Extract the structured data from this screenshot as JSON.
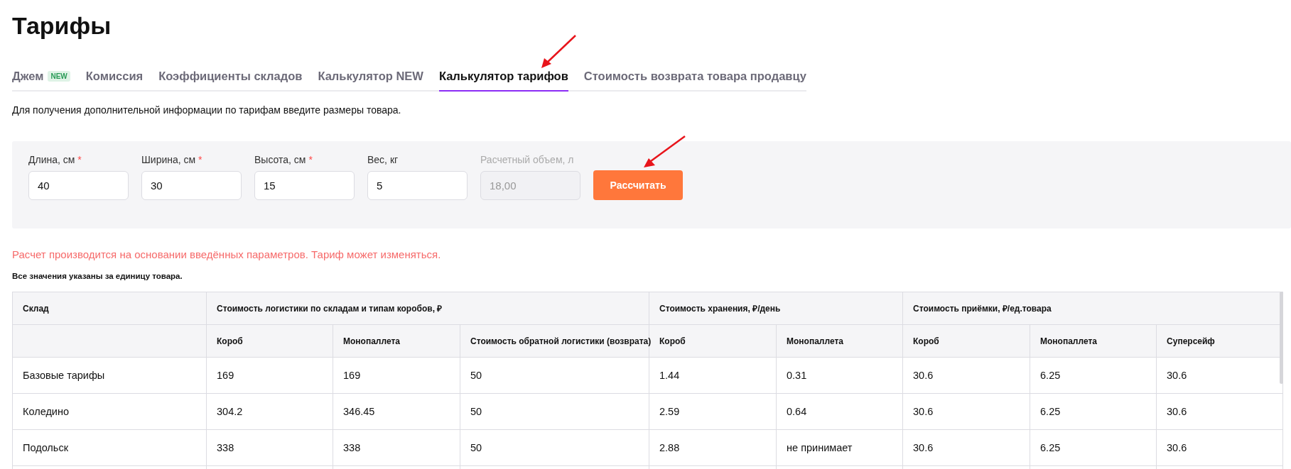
{
  "title": "Тарифы",
  "tabs": [
    {
      "label": "Джем",
      "badge": "NEW",
      "selected": false
    },
    {
      "label": "Комиссия",
      "selected": false
    },
    {
      "label": "Коэффициенты складов",
      "selected": false
    },
    {
      "label": "Калькулятор NEW",
      "selected": false
    },
    {
      "label": "Калькулятор тарифов",
      "selected": true
    },
    {
      "label": "Стоимость возврата товара продавцу",
      "selected": false
    }
  ],
  "intro": "Для получения дополнительной информации по тарифам введите размеры товара.",
  "form": {
    "fields": [
      {
        "label": "Длина, см",
        "required_mark": "*",
        "value": "40",
        "disabled": false
      },
      {
        "label": "Ширина, см",
        "required_mark": "*",
        "value": "30",
        "disabled": false
      },
      {
        "label": "Высота, см",
        "required_mark": "*",
        "value": "15",
        "disabled": false
      },
      {
        "label": "Вес, кг",
        "value": "5",
        "disabled": false
      },
      {
        "label": "Расчетный объем, л",
        "value": "18,00",
        "disabled": true
      }
    ],
    "button": "Рассчитать"
  },
  "warning": "Расчет производится на основании введённых параметров. Тариф может изменяться.",
  "note": "Все значения указаны за единицу товара.",
  "table": {
    "groups": [
      {
        "label": "Склад"
      },
      {
        "label": "Стоимость логистики по складам и типам коробов, ₽",
        "columns": [
          "Короб",
          "Монопаллета",
          "Стоимость обратной логистики (возврата)"
        ]
      },
      {
        "label": "Стоимость хранения, ₽/день",
        "columns": [
          "Короб",
          "Монопаллета"
        ]
      },
      {
        "label": "Стоимость приёмки, ₽/ед.товара",
        "columns": [
          "Короб",
          "Монопаллета",
          "Суперсейф"
        ]
      }
    ],
    "rows": [
      [
        "Базовые тарифы",
        "169",
        "169",
        "50",
        "1.44",
        "0.31",
        "30.6",
        "6.25",
        "30.6"
      ],
      [
        "Коледино",
        "304.2",
        "346.45",
        "50",
        "2.59",
        "0.64",
        "30.6",
        "6.25",
        "30.6"
      ],
      [
        "Подольск",
        "338",
        "338",
        "50",
        "2.88",
        "не принимает",
        "30.6",
        "6.25",
        "30.6"
      ]
    ]
  }
}
